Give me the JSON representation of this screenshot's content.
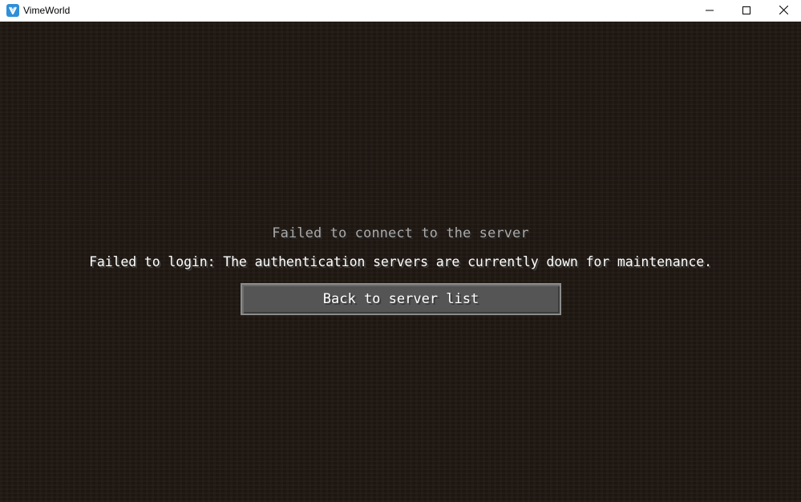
{
  "window": {
    "title": "VimeWorld",
    "icon": "vimeworld-logo-icon",
    "controls": [
      "minimize-icon",
      "maximize-icon",
      "close-icon"
    ]
  },
  "screen": {
    "heading": "Failed to connect to the server",
    "message": "Failed to login: The authentication servers are currently down for maintenance.",
    "back_button_label": "Back to server list"
  },
  "colors": {
    "background": "#1f1711",
    "heading_text": "#a9a9a9",
    "message_text": "#ffffff",
    "button_fill": "#555555",
    "button_border": "#8b8b8b"
  }
}
